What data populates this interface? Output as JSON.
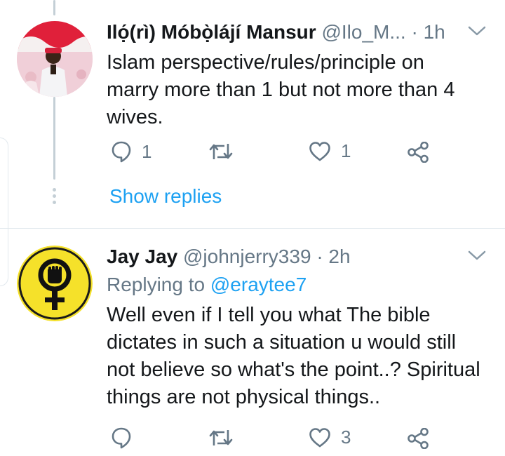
{
  "tweets": [
    {
      "author_name": "Ilọ́(rì) Móbọ̀lájí Mansur",
      "handle": "@Ilo_M...",
      "separator": "·",
      "time": "1h",
      "text": "Islam perspective/rules/principle on marry more than 1 but not more than 4 wives.",
      "reply_count": "1",
      "retweet_count": "",
      "like_count": "1",
      "show_replies_label": "Show replies"
    },
    {
      "author_name": "Jay Jay",
      "handle": "@johnjerry339",
      "separator": "·",
      "time": "2h",
      "replying_prefix": "Replying to ",
      "replying_handle": "@eraytee7",
      "text": "Well even if I tell you what The bible dictates in such a situation u would still not believe so what's the point..? Spiritual things are not physical things..",
      "reply_count": "",
      "retweet_count": "",
      "like_count": "3"
    }
  ],
  "icons": {
    "reply": "reply-icon",
    "retweet": "retweet-icon",
    "like": "heart-icon",
    "share": "share-icon",
    "menu": "chevron-down-icon"
  },
  "colors": {
    "accent": "#1da1f2",
    "muted": "#657786",
    "avatar2_bg": "#f5e12a"
  }
}
